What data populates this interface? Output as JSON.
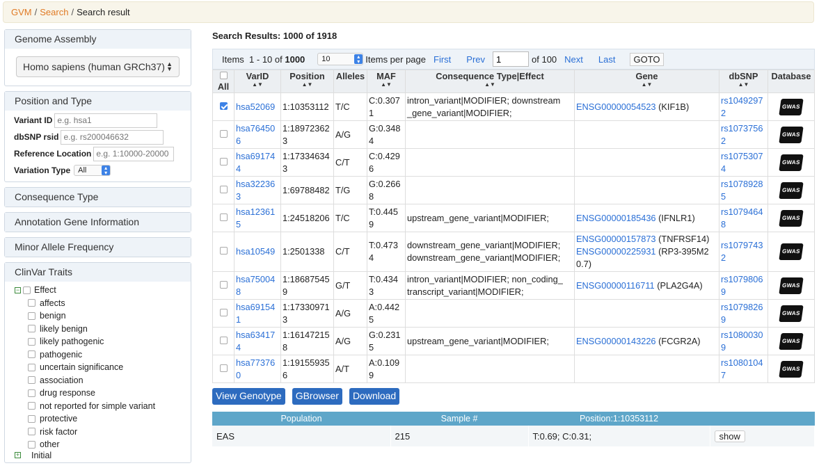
{
  "breadcrumb": {
    "home": "GVM",
    "search": "Search",
    "current": "Search result"
  },
  "sidebar": {
    "genome_assembly": {
      "title": "Genome Assembly",
      "value": "Homo sapiens (human GRCh37)"
    },
    "position_type": {
      "title": "Position and Type",
      "variant_id": {
        "label": "Variant ID",
        "placeholder": "e.g. hsa1"
      },
      "dbsnp": {
        "label": "dbSNP rsid",
        "placeholder": "e.g. rs200046632"
      },
      "ref_loc": {
        "label": "Reference Location",
        "placeholder": "e.g. 1:10000-20000"
      },
      "variation_type": {
        "label": "Variation Type",
        "value": "All"
      }
    },
    "consequence_type": "Consequence Type",
    "annotation_gene": "Annotation Gene Information",
    "maf": "Minor Allele Frequency",
    "clinvar": {
      "title": "ClinVar Traits",
      "effect": "Effect",
      "items": [
        "affects",
        "benign",
        "likely benign",
        "likely pathogenic",
        "pathogenic",
        "uncertain significance",
        "association",
        "drug response",
        "not reported for simple variant",
        "protective",
        "risk factor",
        "other"
      ],
      "initial": "Initial"
    }
  },
  "main": {
    "title": "Search Results: 1000 of 1918",
    "pager": {
      "items_label": "Items",
      "range": "1 - 10 of",
      "total": "1000",
      "per_page": "10",
      "per_page_label": "Items per page",
      "first": "First",
      "prev": "Prev",
      "page": "1",
      "of": "of 100",
      "next": "Next",
      "last": "Last",
      "goto": "GOTO"
    },
    "columns": {
      "all": "All",
      "varid": "VarID",
      "position": "Position",
      "alleles": "Alleles",
      "maf": "MAF",
      "consequence": "Consequence Type|Effect",
      "gene": "Gene",
      "dbsnp": "dbSNP",
      "database": "Database"
    },
    "rows": [
      {
        "checked": true,
        "varid": "hsa52069",
        "pos": "1:10353112",
        "alleles": "T/C",
        "maf": "C:0.307 1",
        "cons": [
          "intron_variant|MODIFIER; downstream _gene_variant|MODIFIER;"
        ],
        "gene_id": [
          "ENSG00000054523"
        ],
        "gene_name": [
          "(KIF1B)"
        ],
        "dbsnp": "rs1049297 2",
        "db": "GWAS"
      },
      {
        "checked": false,
        "varid": "hsa76450 6",
        "pos": "1:18972362 3",
        "alleles": "A/G",
        "maf": "G:0.348 4",
        "cons": [
          ""
        ],
        "gene_id": [
          ""
        ],
        "gene_name": [
          ""
        ],
        "dbsnp": "rs1073756 2",
        "db": "GWAS"
      },
      {
        "checked": false,
        "varid": "hsa69174 4",
        "pos": "1:17334634 3",
        "alleles": "C/T",
        "maf": "C:0.429 6",
        "cons": [
          ""
        ],
        "gene_id": [
          ""
        ],
        "gene_name": [
          ""
        ],
        "dbsnp": "rs1075307 4",
        "db": "GWAS"
      },
      {
        "checked": false,
        "varid": "hsa32236 3",
        "pos": "1:69788482",
        "alleles": "T/G",
        "maf": "G:0.266 8",
        "cons": [
          ""
        ],
        "gene_id": [
          ""
        ],
        "gene_name": [
          ""
        ],
        "dbsnp": "rs1078928 5",
        "db": "GWAS"
      },
      {
        "checked": false,
        "varid": "hsa12361 5",
        "pos": "1:24518206",
        "alleles": "T/C",
        "maf": "T:0.445 9",
        "cons": [
          "upstream_gene_variant|MODIFIER;"
        ],
        "gene_id": [
          "ENSG00000185436"
        ],
        "gene_name": [
          "(IFNLR1)"
        ],
        "dbsnp": "rs1079464 8",
        "db": "GWAS"
      },
      {
        "checked": false,
        "varid": "hsa10549",
        "pos": "1:2501338",
        "alleles": "C/T",
        "maf": "T:0.473 4",
        "cons": [
          "downstream_gene_variant|MODIFIER;",
          "downstream_gene_variant|MODIFIER;"
        ],
        "gene_id": [
          "ENSG00000157873",
          "ENSG00000225931"
        ],
        "gene_name": [
          "(TNFRSF14)",
          "(RP3-395M2 0.7)"
        ],
        "dbsnp": "rs1079743 2",
        "db": "GWAS"
      },
      {
        "checked": false,
        "varid": "hsa75004 8",
        "pos": "1:18687545 9",
        "alleles": "G/T",
        "maf": "T:0.434 3",
        "cons": [
          "intron_variant|MODIFIER; non_coding_ transcript_variant|MODIFIER;"
        ],
        "gene_id": [
          "ENSG00000116711"
        ],
        "gene_name": [
          "(PLA2G4A)"
        ],
        "dbsnp": "rs1079806 9",
        "db": "GWAS"
      },
      {
        "checked": false,
        "varid": "hsa69154 1",
        "pos": "1:17330971 3",
        "alleles": "A/G",
        "maf": "A:0.442 5",
        "cons": [
          ""
        ],
        "gene_id": [
          ""
        ],
        "gene_name": [
          ""
        ],
        "dbsnp": "rs1079826 9",
        "db": "GWAS"
      },
      {
        "checked": false,
        "varid": "hsa63417 4",
        "pos": "1:16147215 8",
        "alleles": "A/G",
        "maf": "G:0.231 5",
        "cons": [
          "upstream_gene_variant|MODIFIER;"
        ],
        "gene_id": [
          "ENSG00000143226"
        ],
        "gene_name": [
          "(FCGR2A)"
        ],
        "dbsnp": "rs1080030 9",
        "db": "GWAS"
      },
      {
        "checked": false,
        "varid": "hsa77376 0",
        "pos": "1:19155935 6",
        "alleles": "A/T",
        "maf": "A:0.109 9",
        "cons": [
          ""
        ],
        "gene_id": [
          ""
        ],
        "gene_name": [
          ""
        ],
        "dbsnp": "rs1080104 7",
        "db": "GWAS"
      }
    ],
    "buttons": {
      "genotype": "View Genotype",
      "gbrowser": "GBrowser",
      "download": "Download"
    },
    "population": {
      "headers": [
        "Population",
        "Sample #",
        "Position:1:10353112",
        ""
      ],
      "row": {
        "pop": "EAS",
        "sample": "215",
        "freq": "T:0.69; C:0.31;",
        "action": "show"
      }
    }
  }
}
